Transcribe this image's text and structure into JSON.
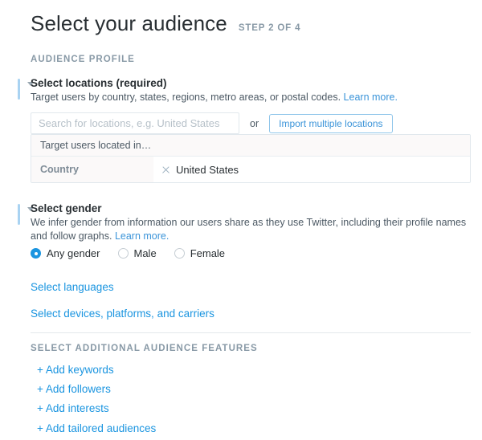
{
  "header": {
    "title": "Select your audience",
    "step": "STEP 2 OF 4"
  },
  "sections": {
    "audience_profile_heading": "AUDIENCE PROFILE",
    "additional_features_heading": "SELECT ADDITIONAL AUDIENCE FEATURES"
  },
  "locations": {
    "title": "Select locations (required)",
    "description": "Target users by country, states, regions, metro areas, or postal codes.",
    "learn_more": "Learn more.",
    "search_placeholder": "Search for locations, e.g. United States",
    "search_value": "",
    "or_label": "or",
    "import_button": "Import multiple locations",
    "table": {
      "header": "Target users located in…",
      "columns": [
        "Country"
      ],
      "rows": [
        {
          "label": "Country",
          "value": "United States",
          "remove_icon": "close-icon"
        }
      ]
    }
  },
  "gender": {
    "title": "Select gender",
    "description": "We infer gender from information our users share as they use Twitter, including their profile names and follow graphs.",
    "learn_more": "Learn more.",
    "options": [
      {
        "label": "Any gender",
        "selected": true
      },
      {
        "label": "Male",
        "selected": false
      },
      {
        "label": "Female",
        "selected": false
      }
    ]
  },
  "links": {
    "languages": "Select languages",
    "devices": "Select devices, platforms, and carriers"
  },
  "additional_features": [
    "+ Add keywords",
    "+ Add followers",
    "+ Add interests",
    "+ Add tailored audiences"
  ],
  "colors": {
    "accent_blue": "#1b95e0",
    "link_blue": "#3b94d9",
    "muted_gray": "#8899a6",
    "border_gray": "#e1e8ed",
    "row_bg": "#fbf9f9"
  }
}
